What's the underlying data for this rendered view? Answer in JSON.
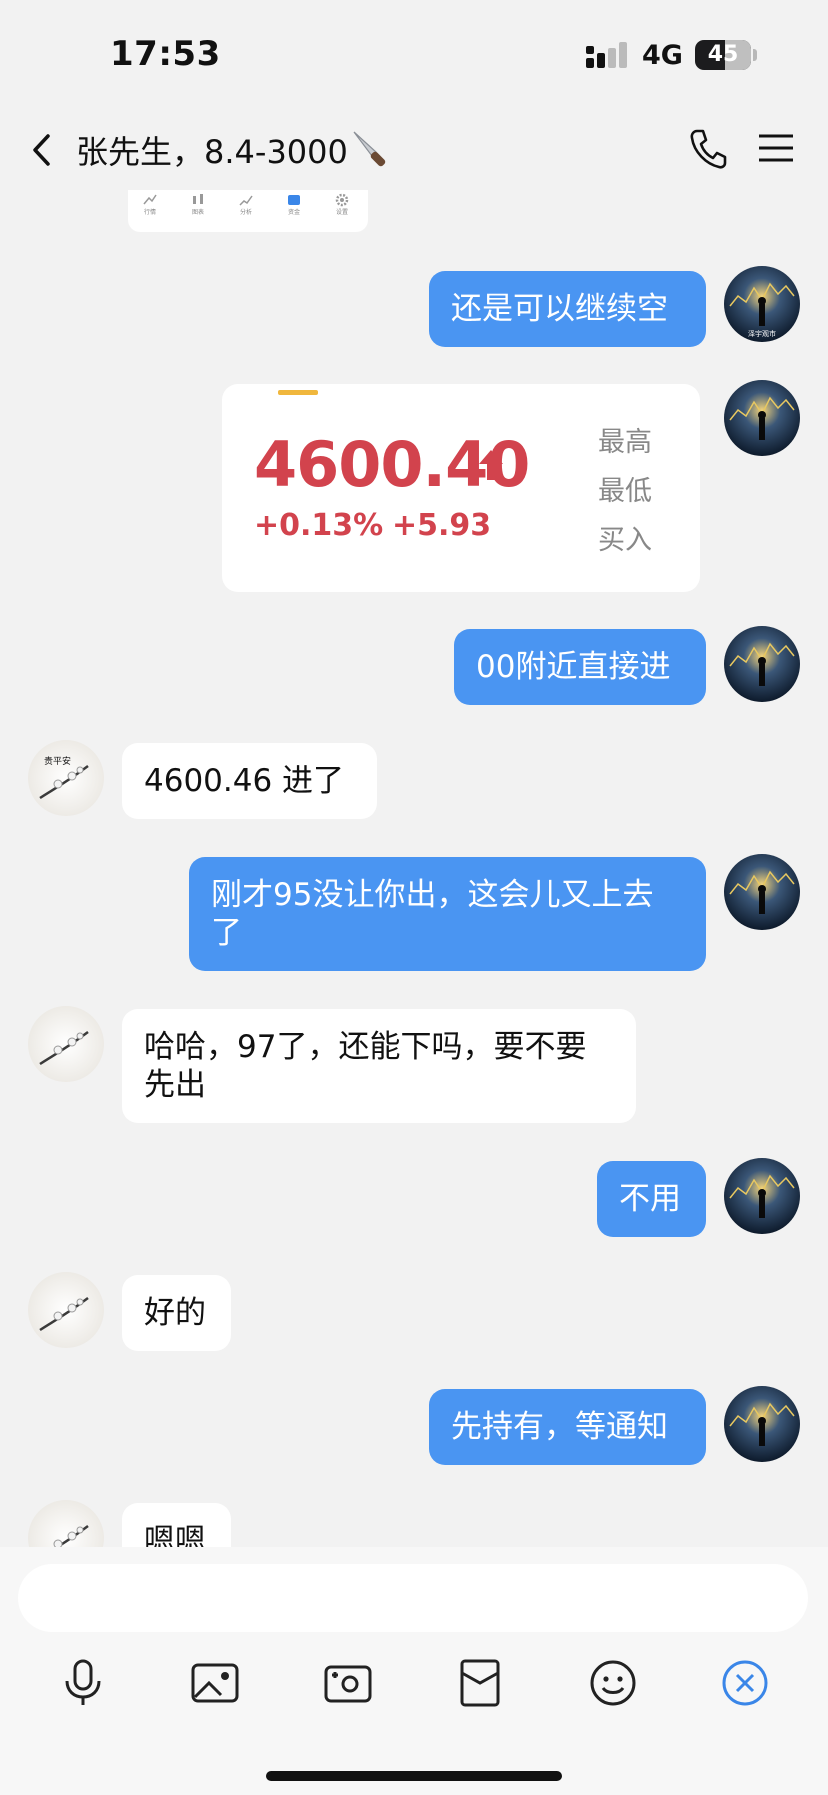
{
  "status_bar": {
    "time": "17:53",
    "network": "4G",
    "battery": "45"
  },
  "nav": {
    "title": "张先生，8.4-3000"
  },
  "image_strip": {
    "tabs": [
      "行情",
      "图表",
      "分析",
      "资金",
      "设置"
    ]
  },
  "messages": [
    {
      "side": "out",
      "text": "还是可以继续空"
    },
    {
      "side": "out",
      "type": "quote",
      "price": "4600.40",
      "percent": "+0.13%",
      "change": "+5.93",
      "labels": [
        "最高",
        "最低",
        "买入"
      ]
    },
    {
      "side": "out",
      "text": "00附近直接进"
    },
    {
      "side": "in",
      "text": "4600.46 进了"
    },
    {
      "side": "out",
      "text": "刚才95没让你出，这会儿又上去了"
    },
    {
      "side": "in",
      "text": "哈哈，97了，还能下吗，要不要先出"
    },
    {
      "side": "out",
      "text": "不用"
    },
    {
      "side": "in",
      "text": "好的"
    },
    {
      "side": "out",
      "text": "先持有，等通知"
    },
    {
      "side": "in",
      "text": "嗯嗯"
    }
  ],
  "avatars": {
    "self_text": "泽宇观市",
    "contact_text": "贵平安"
  },
  "input": {
    "placeholder": ""
  },
  "toolbar": [
    "microphone-icon",
    "image-icon",
    "camera-icon",
    "red-packet-icon",
    "emoji-icon",
    "close-icon"
  ],
  "colors": {
    "bubble_out": "#4a95f2",
    "price_up": "#d2434d",
    "background": "#f2f2f2"
  }
}
